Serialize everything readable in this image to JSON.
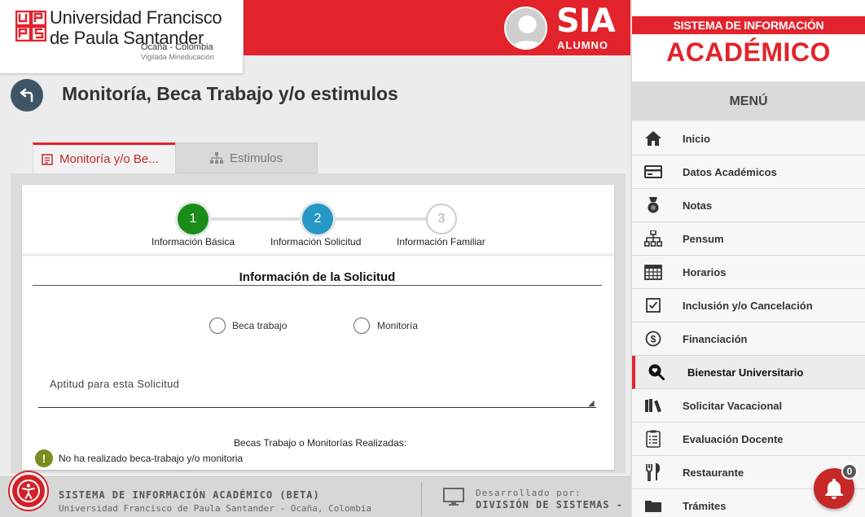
{
  "header": {
    "university_line1": "Universidad Francisco",
    "university_line2": "de Paula Santander",
    "university_location": "Ocaña - Colombia",
    "university_oversight": "Vigilada Mineducación",
    "app_name": "SIA",
    "app_role": "ALUMNO",
    "brand_color": "#e3232c"
  },
  "page": {
    "title": "Monitoría, Beca Trabajo y/o estimulos"
  },
  "tabs": [
    {
      "label": "Monitoría y/o Be...",
      "icon": "form-icon",
      "active": true
    },
    {
      "label": "Estimulos",
      "icon": "sitemap-icon",
      "active": false
    }
  ],
  "steps": [
    {
      "number": "1",
      "label": "Información Básica",
      "state": "done"
    },
    {
      "number": "2",
      "label": "Información Solicitud",
      "state": "current"
    },
    {
      "number": "3",
      "label": "Información Familiar",
      "state": "pending"
    }
  ],
  "form": {
    "section_title": "Información de la Solicitud",
    "options": [
      {
        "label": "Beca trabajo",
        "checked": false
      },
      {
        "label": "Monitoría",
        "checked": false
      }
    ],
    "aptitud_label": "Aptitud para esta Solicitud",
    "aptitud_value": "",
    "realizadas_label": "Becas Trabajo o Monitorías Realizadas:",
    "realizadas_message": "No ha realizado beca-trabajo y/o monitoria"
  },
  "footer": {
    "system_name": "SISTEMA DE INFORMACIÓN ACADÉMICO (BETA)",
    "institution": "Universidad Francisco de Paula Santander - Ocaña, Colombia",
    "developed_by_label": "Desarrollado por:",
    "developer": "DIVISIÓN DE SISTEMAS -"
  },
  "sidebar": {
    "system_label": "SISTEMA DE INFORMACIÓN",
    "academic_label": "ACADÉMICO",
    "menu_label": "MENÚ",
    "items": [
      {
        "label": "Inicio",
        "icon": "home-icon"
      },
      {
        "label": "Datos Académicos",
        "icon": "id-card-icon"
      },
      {
        "label": "Notas",
        "icon": "medal-icon"
      },
      {
        "label": "Pensum",
        "icon": "sitemap-icon"
      },
      {
        "label": "Horarios",
        "icon": "calendar-icon"
      },
      {
        "label": "Inclusión y/o Cancelación",
        "icon": "checkbox-icon"
      },
      {
        "label": "Financiación",
        "icon": "dollar-icon"
      },
      {
        "label": "Bienestar Universitario",
        "icon": "search-heart-icon",
        "active": true
      },
      {
        "label": "Solicitar Vacacional",
        "icon": "books-icon"
      },
      {
        "label": "Evaluación Docente",
        "icon": "clipboard-icon"
      },
      {
        "label": "Restaurante",
        "icon": "utensils-icon"
      },
      {
        "label": "Trámites",
        "icon": "folder-icon"
      }
    ]
  },
  "notifications": {
    "count": "0"
  }
}
